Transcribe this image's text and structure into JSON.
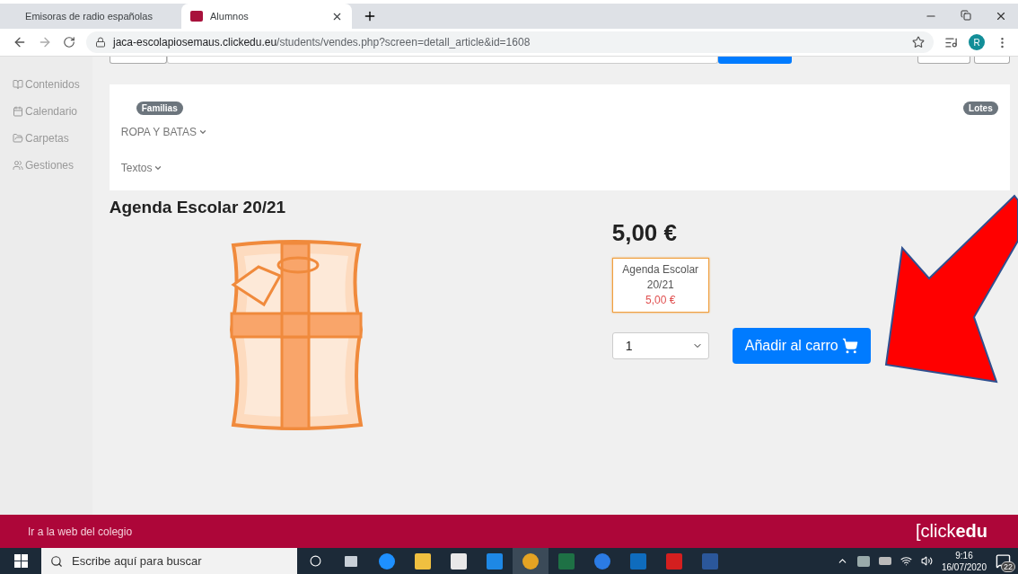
{
  "browser": {
    "tabs": [
      {
        "title": "Emisoras de radio españolas",
        "selected": false,
        "audio": true
      },
      {
        "title": "Alumnos",
        "selected": true,
        "audio": false
      }
    ],
    "url_host": "jaca-escolapiosemaus.clickedu.eu",
    "url_path": "/students/vendes.php?screen=detall_article&id=1608",
    "profile_initial": "R"
  },
  "sidebar": {
    "items": [
      {
        "label": "Contenidos"
      },
      {
        "label": "Calendario"
      },
      {
        "label": "Carpetas"
      },
      {
        "label": "Gestiones"
      }
    ]
  },
  "filters": {
    "left_badge": "Familias",
    "right_badge": "Lotes",
    "menus": [
      "ROPA Y BATAS",
      "Textos"
    ]
  },
  "product": {
    "title": "Agenda Escolar 20/21",
    "price": "5,00 €",
    "options": [
      {
        "name": "Agenda Escolar 20/21",
        "price": "5,00 €",
        "selected": true
      }
    ],
    "quantity": "1",
    "add_button": "Añadir al carro"
  },
  "footer": {
    "link": "Ir a la web del colegio",
    "logo_light": "[click",
    "logo_bold": "edu"
  },
  "taskbar": {
    "search_placeholder": "Escribe aquí para buscar",
    "time": "9:16",
    "date": "16/07/2020",
    "notifications": "22"
  }
}
